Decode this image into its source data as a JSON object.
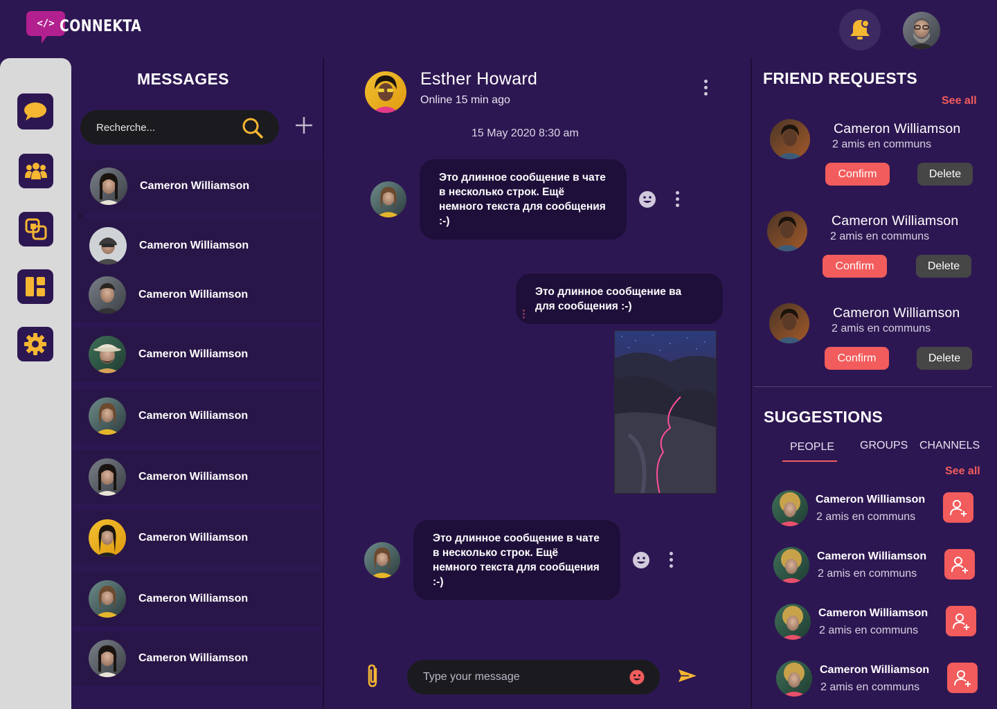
{
  "app": {
    "brand": "CONNEKTA",
    "logo_glyph": "</>"
  },
  "colors": {
    "background": "#2d1752",
    "accent": "#f25c5c",
    "highlight": "#f5b632",
    "rail": "#d9d9d9",
    "bubble": "#1e0f3a"
  },
  "rail_icons": [
    "chat-icon",
    "group-icon",
    "link-icon",
    "dashboard-icon",
    "settings-icon"
  ],
  "messages": {
    "title": "MESSAGES",
    "search_placeholder": "Recherche...",
    "conversations": [
      {
        "name": "Cameron Williamson"
      },
      {
        "name": "Cameron Williamson"
      },
      {
        "name": "Cameron Williamson"
      },
      {
        "name": "Cameron Williamson"
      },
      {
        "name": "Cameron Williamson"
      },
      {
        "name": "Cameron Williamson"
      },
      {
        "name": "Cameron Williamson"
      },
      {
        "name": "Cameron Williamson"
      },
      {
        "name": "Cameron Williamson"
      }
    ]
  },
  "chat": {
    "contact_name": "Esther Howard",
    "status": "Online 15 min ago",
    "date": "15 May 2020 8:30 am",
    "messages": [
      {
        "text": "Это длинное сообщение в чате в несколько строк. Ещё немного текста для сообщения :-)"
      },
      {
        "text": "Это длинное сообщение ва для сообщения :-)"
      },
      {
        "text": "Это длинное сообщение в чате в несколько строк. Ещё немного текста для сообщения :-)"
      }
    ],
    "compose_placeholder": "Type your message"
  },
  "friend_requests": {
    "title": "FRIEND REQUESTS",
    "see_all": "See all",
    "items": [
      {
        "name": "Cameron Williamson",
        "mutual": "2 amis en communs",
        "confirm": "Confirm",
        "delete": "Delete"
      },
      {
        "name": "Cameron Williamson",
        "mutual": "2 amis en communs",
        "confirm": "Confirm",
        "delete": "Delete"
      },
      {
        "name": "Cameron Williamson",
        "mutual": "2 amis en communs",
        "confirm": "Confirm",
        "delete": "Delete"
      }
    ]
  },
  "suggestions": {
    "title": "SUGGESTIONS",
    "tabs": [
      "PEOPLE",
      "GROUPS",
      "CHANNELS"
    ],
    "active_tab": "PEOPLE",
    "see_all": "See all",
    "items": [
      {
        "name": "Cameron Williamson",
        "mutual": "2 amis en communs"
      },
      {
        "name": "Cameron Williamson",
        "mutual": "2 amis en communs"
      },
      {
        "name": "Cameron Williamson",
        "mutual": "2 amis en communs"
      },
      {
        "name": "Cameron Williamson",
        "mutual": "2 amis en communs"
      }
    ]
  }
}
